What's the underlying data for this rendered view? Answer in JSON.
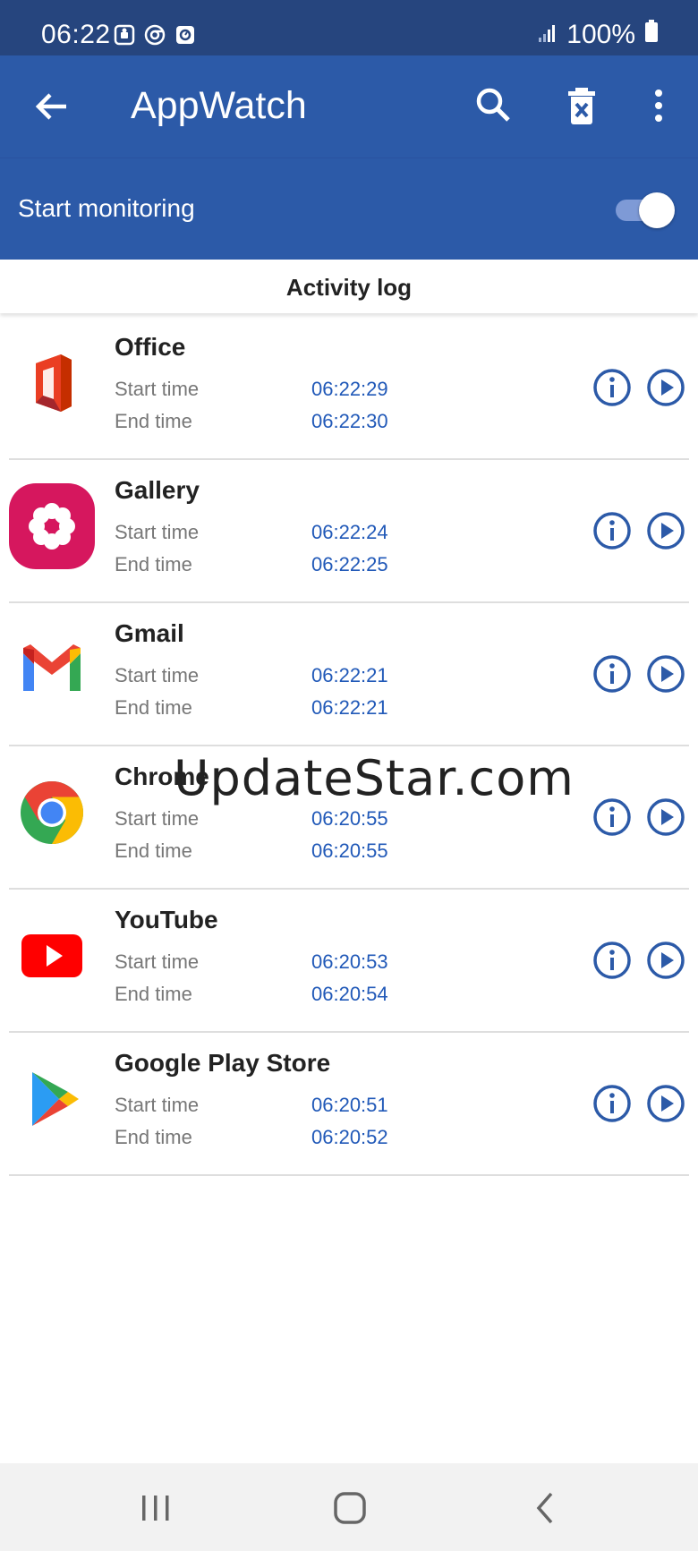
{
  "status_bar": {
    "time": "06:22",
    "battery": "100%"
  },
  "app_bar": {
    "title": "AppWatch"
  },
  "monitoring": {
    "label": "Start monitoring",
    "enabled": true
  },
  "section": {
    "title": "Activity log"
  },
  "labels": {
    "start": "Start time",
    "end": "End time"
  },
  "entries": [
    {
      "name": "Office",
      "start": "06:22:29",
      "end": "06:22:30",
      "icon": "office-icon"
    },
    {
      "name": "Gallery",
      "start": "06:22:24",
      "end": "06:22:25",
      "icon": "gallery-icon"
    },
    {
      "name": "Gmail",
      "start": "06:22:21",
      "end": "06:22:21",
      "icon": "gmail-icon"
    },
    {
      "name": "Chrome",
      "start": "06:20:55",
      "end": "06:20:55",
      "icon": "chrome-icon"
    },
    {
      "name": "YouTube",
      "start": "06:20:53",
      "end": "06:20:54",
      "icon": "youtube-icon"
    },
    {
      "name": "Google Play Store",
      "start": "06:20:51",
      "end": "06:20:52",
      "icon": "play-store-icon"
    }
  ],
  "watermark": "UpdateStar.com",
  "colors": {
    "status_bar": "#26457e",
    "app_bar": "#2c5aa8",
    "accent": "#2159b8"
  }
}
